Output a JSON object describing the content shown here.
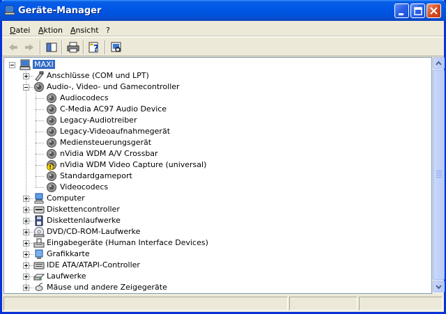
{
  "window": {
    "title": "Geräte-Manager"
  },
  "menu": [
    "Datei",
    "Aktion",
    "Ansicht",
    "?"
  ],
  "toolbar": {
    "buttons": [
      "back-arrow-icon",
      "forward-arrow-icon",
      "console-tree-icon",
      "print-icon",
      "properties-help-icon",
      "scan-hardware-icon"
    ]
  },
  "tree": {
    "root": "MAXI",
    "items": [
      {
        "label": "Anschlüsse (COM und LPT)",
        "icon": "port-connector-icon",
        "expanded": false
      },
      {
        "label": "Audio-, Video- und Gamecontroller",
        "icon": "speaker-icon",
        "expanded": true,
        "children": [
          {
            "label": "Audiocodecs",
            "icon": "speaker-icon"
          },
          {
            "label": "C-Media AC97 Audio Device",
            "icon": "speaker-icon"
          },
          {
            "label": "Legacy-Audiotreiber",
            "icon": "speaker-icon"
          },
          {
            "label": "Legacy-Videoaufnahmegerät",
            "icon": "speaker-icon"
          },
          {
            "label": "Mediensteuerungsgerät",
            "icon": "speaker-icon"
          },
          {
            "label": "nVidia WDM A/V Crossbar",
            "icon": "speaker-icon"
          },
          {
            "label": "nVidia WDM Video Capture (universal)",
            "icon": "warning-device-icon"
          },
          {
            "label": "Standardgameport",
            "icon": "speaker-icon"
          },
          {
            "label": "Videocodecs",
            "icon": "speaker-icon"
          }
        ]
      },
      {
        "label": "Computer",
        "icon": "computer-icon",
        "expanded": false
      },
      {
        "label": "Diskettencontroller",
        "icon": "floppy-controller-icon",
        "expanded": false
      },
      {
        "label": "Diskettenlaufwerke",
        "icon": "floppy-drive-icon",
        "expanded": false
      },
      {
        "label": "DVD/CD-ROM-Laufwerke",
        "icon": "cd-drive-icon",
        "expanded": false
      },
      {
        "label": "Eingabegeräte (Human Interface Devices)",
        "icon": "hid-icon",
        "expanded": false
      },
      {
        "label": "Grafikkarte",
        "icon": "display-adapter-icon",
        "expanded": false
      },
      {
        "label": "IDE ATA/ATAPI-Controller",
        "icon": "ide-controller-icon",
        "expanded": false
      },
      {
        "label": "Laufwerke",
        "icon": "hard-drive-icon",
        "expanded": false
      },
      {
        "label": "Mäuse und andere Zeigegeräte",
        "icon": "mouse-icon",
        "expanded": false
      }
    ]
  },
  "colors": {
    "titlebar": "#0058e6",
    "selection": "#316ac5",
    "frame": "#0831d9",
    "warning": "#f5d800"
  }
}
